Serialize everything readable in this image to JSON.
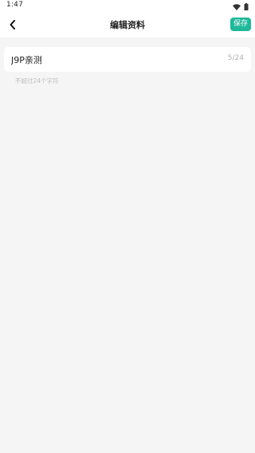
{
  "status_bar": {
    "time": "1:47",
    "icons": [
      "wifi-icon",
      "battery-icon"
    ]
  },
  "header": {
    "back_icon": "chevron-left-icon",
    "title": "编辑资料",
    "save_label": "保存"
  },
  "name_field": {
    "value": "J9P亲测",
    "counter": "5/24"
  },
  "hint": "不超过24个字符",
  "colors": {
    "accent": "#1fb89a",
    "background": "#f5f5f5",
    "card": "#ffffff",
    "muted_text": "#b3b3b3"
  }
}
